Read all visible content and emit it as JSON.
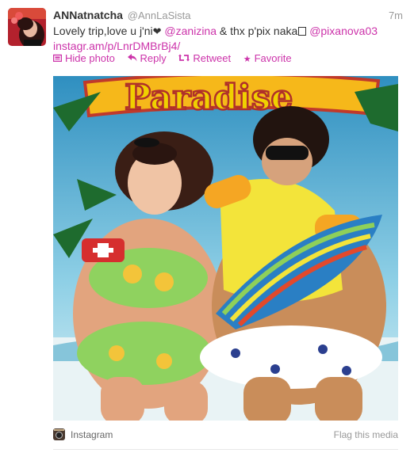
{
  "tweet": {
    "fullname": "ANNatnatcha",
    "username": "@AnnLaSista",
    "time": "7m",
    "text_part1": "Lovely trip,love u j'ni",
    "heart": "❤",
    "mention1": "@zanizina",
    "text_part2": " & thx p'pix naka",
    "mention2": "@pixanova03",
    "link": "instagr.am/p/LnrDMBrBj4/",
    "actions": {
      "hide_photo": "Hide photo",
      "reply": "Reply",
      "retweet": "Retweet",
      "favorite": "Favorite"
    }
  },
  "media": {
    "sign_text": "Paradise",
    "source": "Instagram",
    "flag": "Flag this media"
  },
  "colors": {
    "link": "#cc33aa",
    "muted": "#999999"
  }
}
